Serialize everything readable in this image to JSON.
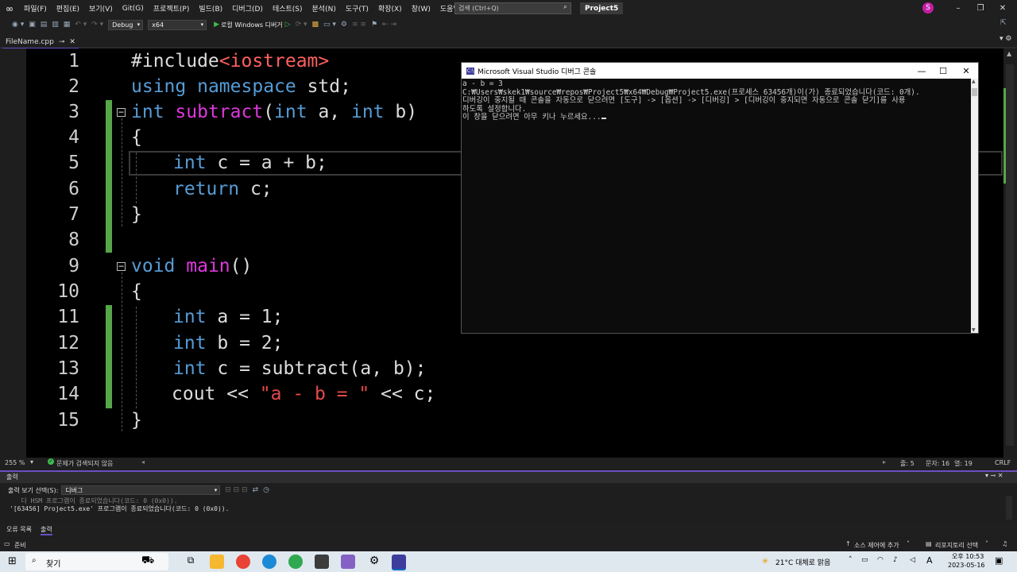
{
  "menu": {
    "items": [
      "파일(F)",
      "편집(E)",
      "보기(V)",
      "Git(G)",
      "프로젝트(P)",
      "빌드(B)",
      "디버그(D)",
      "테스트(S)",
      "분석(N)",
      "도구(T)",
      "확장(X)",
      "창(W)",
      "도움말(H)"
    ],
    "search_placeholder": "검색 (Ctrl+Q)",
    "project_name": "Project5",
    "avatar_letter": "S"
  },
  "toolbar": {
    "config": "Debug",
    "platform": "x64",
    "run_label": "로컬 Windows 디버거"
  },
  "tab": {
    "filename": "FileName.cpp"
  },
  "editor": {
    "lines": [
      "1",
      "2",
      "3",
      "4",
      "5",
      "6",
      "7",
      "8",
      "9",
      "10",
      "11",
      "12",
      "13",
      "14",
      "15"
    ],
    "zoom": "255 %",
    "issues": "문제가 검색되지 않음",
    "cursor_line": "줄: 5",
    "cursor_char": "문자: 16",
    "cursor_col": "열: 19",
    "line_ending": "CRLF"
  },
  "console": {
    "title": "Microsoft Visual Studio 디버그 콘솔",
    "lines": [
      "a - b = 3",
      "C:₩Users₩skek1₩source₩repos₩Project5₩x64₩Debug₩Project5.exe(프로세스 63456개)이(가) 종료되었습니다(코드: 0개).",
      "디버깅이 중지될 때 콘솔을 자동으로 닫으려면 [도구] -> [옵션] -> [디버깅] > [디버깅이 중지되면 자동으로 콘솔 닫기]를 사용",
      "하도록 설정합니다.",
      "이 창을 닫으려면 아무 키나 누르세요..."
    ]
  },
  "output": {
    "title": "출력",
    "show_label": "출력 보기 선택(S):",
    "show_value": "디버그",
    "text_line1": "   다 HSM 프로그램이 종료되었습니다(코드: 0 (0x0)).",
    "text_line2": "'[63456] Project5.exe' 프로그램이 종료되었습니다(코드: 0 (0x0))."
  },
  "bottom_tabs": [
    "오류 목록",
    "출력"
  ],
  "status": {
    "ready": "준비",
    "source_control": "소스 제어에 추가",
    "repo": "리포지토리 선택"
  },
  "taskbar": {
    "search": "찾기",
    "weather": "21°C  대체로 맑음",
    "lang": "A",
    "time": "오후 10:53",
    "date": "2023-05-16"
  }
}
